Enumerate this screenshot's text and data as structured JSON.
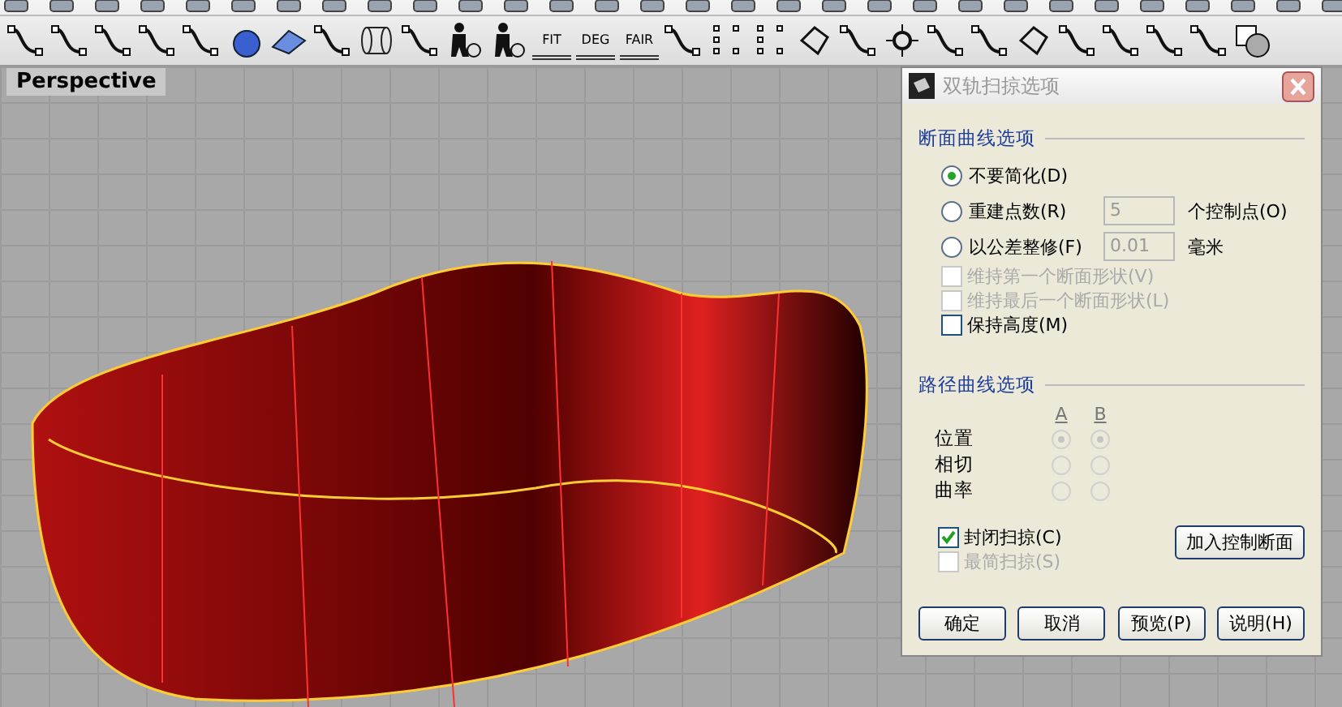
{
  "toolbar": {
    "text_buttons": [
      "FIT",
      "DEG",
      "FAIR"
    ]
  },
  "viewport": {
    "tab": "Perspective"
  },
  "dialog": {
    "title": "双轨扫掠选项",
    "section_1": {
      "title": "断面曲线选项",
      "options": [
        {
          "label": "不要简化(D)",
          "selected": true
        },
        {
          "label": "重建点数(R)",
          "selected": false,
          "field": "5",
          "unit": "个控制点(O)"
        },
        {
          "label": "以公差整修(F)",
          "selected": false,
          "field": "0.01",
          "unit": "毫米"
        }
      ],
      "checkboxes": [
        {
          "label": "维持第一个断面形状(V)",
          "checked": false,
          "disabled": true
        },
        {
          "label": "维持最后一个断面形状(L)",
          "checked": false,
          "disabled": true
        },
        {
          "label": "保持高度(M)",
          "checked": false,
          "disabled": false
        }
      ]
    },
    "section_2": {
      "title": "路径曲线选项",
      "columns": [
        "A",
        "B"
      ],
      "rows": [
        {
          "label": "位置",
          "a_selected": true,
          "b_selected": true
        },
        {
          "label": "相切",
          "a_selected": false,
          "b_selected": false
        },
        {
          "label": "曲率",
          "a_selected": false,
          "b_selected": false
        }
      ],
      "checkboxes": [
        {
          "label": "封闭扫掠(C)",
          "checked": true,
          "disabled": false
        },
        {
          "label": "最简扫掠(S)",
          "checked": false,
          "disabled": true
        }
      ],
      "add_button": "加入控制断面"
    },
    "buttons": [
      "确定",
      "取消",
      "预览(P)",
      "说明(H)"
    ]
  }
}
